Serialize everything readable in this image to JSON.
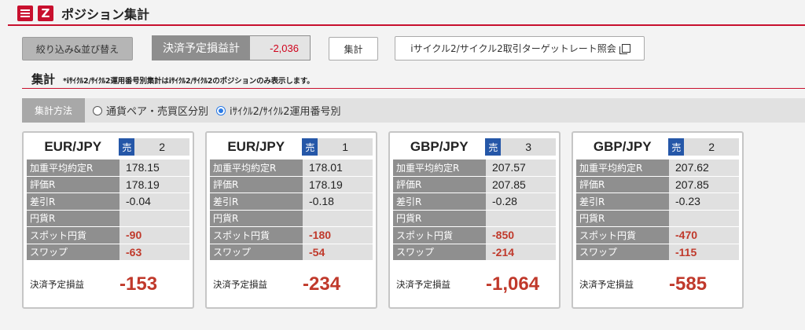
{
  "header": {
    "title": "ポジション集計",
    "logo_letter": "Z"
  },
  "toolbar": {
    "filter_label": "絞り込み&並び替え",
    "pnl_label": "決済予定損益計",
    "pnl_value": "-2,036",
    "sum_label": "集計",
    "rate_label": "iサイクル2/サイクル2取引ターゲットレート照会"
  },
  "section": {
    "title": "集計",
    "note": "*iｻｲｸﾙ2/ｻｲｸﾙ2運用番号別集計はiｻｲｸﾙ2/ｻｲｸﾙ2のポジションのみ表示します。"
  },
  "method": {
    "label": "集計方法",
    "options": [
      {
        "label": "通貨ペア・売買区分別",
        "selected": false
      },
      {
        "label": "iｻｲｸﾙ2/ｻｲｸﾙ2運用番号別",
        "selected": true
      }
    ]
  },
  "row_labels": [
    "加重平均約定R",
    "評価R",
    "差引R",
    "円貨R",
    "スポット円貨",
    "スワップ"
  ],
  "total_label": "決済予定損益",
  "cards": [
    {
      "pair": "EUR/JPY",
      "side": "売",
      "count": "2",
      "values": [
        "178.15",
        "178.19",
        "-0.04",
        "",
        "-90",
        "-63"
      ],
      "total": "-153"
    },
    {
      "pair": "EUR/JPY",
      "side": "売",
      "count": "1",
      "values": [
        "178.01",
        "178.19",
        "-0.18",
        "",
        "-180",
        "-54"
      ],
      "total": "-234"
    },
    {
      "pair": "GBP/JPY",
      "side": "売",
      "count": "3",
      "values": [
        "207.57",
        "207.85",
        "-0.28",
        "",
        "-850",
        "-214"
      ],
      "total": "-1,064"
    },
    {
      "pair": "GBP/JPY",
      "side": "売",
      "count": "2",
      "values": [
        "207.62",
        "207.85",
        "-0.23",
        "",
        "-470",
        "-115"
      ],
      "total": "-585"
    }
  ],
  "colors": {
    "brand": "#c8102e",
    "sell": "#2557a8",
    "negative": "#c0392b"
  }
}
